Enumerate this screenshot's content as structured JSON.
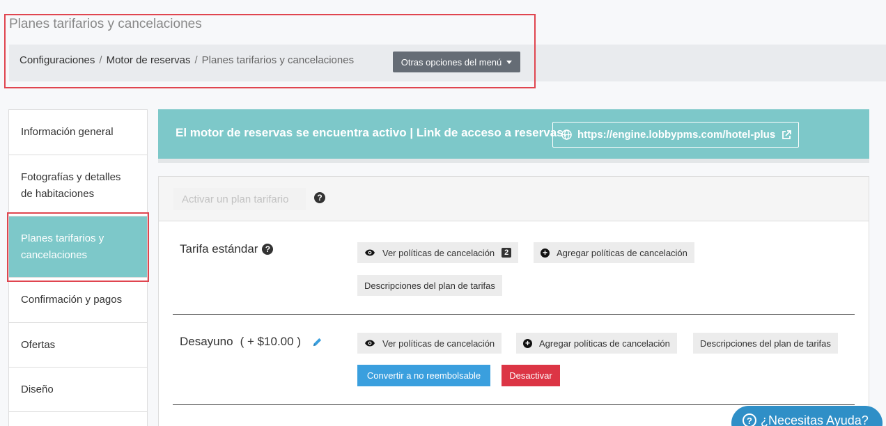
{
  "page": {
    "title": "Planes tarifarios y cancelaciones"
  },
  "breadcrumb": {
    "items": [
      "Configuraciones",
      "Motor de reservas",
      "Planes tarifarios y cancelaciones"
    ],
    "separator": "/"
  },
  "menu_button": {
    "label": "Otras opciones del menú",
    "icon": "caret-down-icon"
  },
  "sidebar": {
    "items": [
      {
        "label": "Información general",
        "active": false
      },
      {
        "label": "Fotografías y detalles de habitaciones",
        "active": false
      },
      {
        "label": "Planes tarifarios y cancelaciones",
        "active": true
      },
      {
        "label": "Confirmación y pagos",
        "active": false
      },
      {
        "label": "Ofertas",
        "active": false
      },
      {
        "label": "Diseño",
        "active": false
      }
    ]
  },
  "banner": {
    "text": "El motor de reservas se encuentra activo | Link de acceso a reservas:",
    "link": "https://engine.lobbypms.com/hotel-plus",
    "icons": [
      "globe-icon",
      "external-link-icon"
    ]
  },
  "panel": {
    "activate_label": "Activar un plan tarifario",
    "rates": [
      {
        "name": "Tarifa estándar",
        "view_label": "Ver políticas de cancelación",
        "view_count": "2",
        "add_label": "Agregar políticas de cancelación",
        "desc_label": "Descripciones del plan de tarifas"
      },
      {
        "name": "Desayuno",
        "price": "( + $10.00 )",
        "view_label": "Ver políticas de cancelación",
        "add_label": "Agregar políticas de cancelación",
        "desc_label": "Descripciones del plan de tarifas",
        "convert_label": "Convertir a no reembolsable",
        "deactivate_label": "Desactivar"
      }
    ]
  },
  "help": {
    "label": "¿Necesitas Ayuda?"
  },
  "colors": {
    "accent": "#7dc8c9",
    "primary": "#3a9fde",
    "danger": "#dc3545",
    "highlight": "#e0454f"
  }
}
